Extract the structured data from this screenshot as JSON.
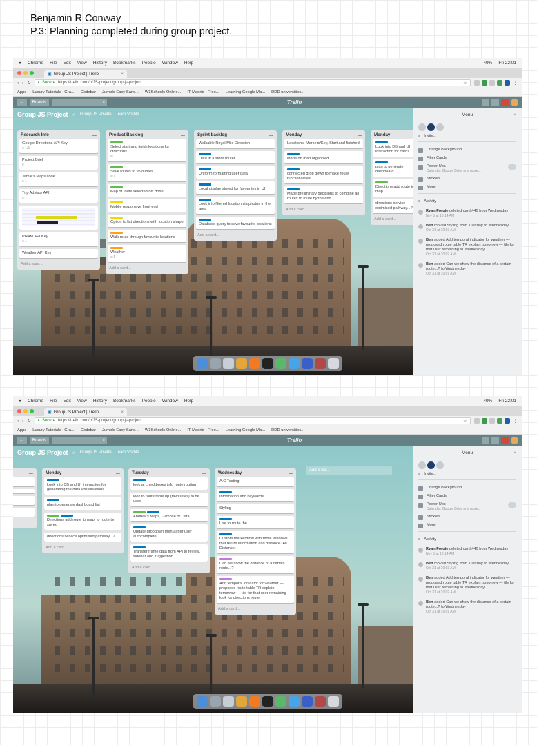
{
  "doc": {
    "author": "Benjamin R Conway",
    "subtitle": "P.3: Planning completed during group project."
  },
  "mac_menubar": {
    "items": [
      "Chrome",
      "File",
      "Edit",
      "View",
      "History",
      "Bookmarks",
      "People",
      "Window",
      "Help"
    ],
    "battery": "49%",
    "clock": "Fri 22:01"
  },
  "browser": {
    "tab_title": "Group JS Project | Trello",
    "url_secure": "Secure",
    "url": "https://trello.com/b/JS-project/group-js-project",
    "bookmarks": [
      "Apps",
      "Luxury Tutorials - Gra...",
      "Codebar",
      "Jumble Easy Sans...",
      "W3Schools Online...",
      "IT Madrid - Free...",
      "Learning Google Ma...",
      "DDD universities..."
    ]
  },
  "trello": {
    "boards_label": "Boards",
    "logo": "Trello",
    "board_title": "Group JS Project",
    "team": "Group JS Private",
    "team_visible": "Team Visible",
    "add_card": "Add a card...",
    "add_list": "Add a list..."
  },
  "screen1": {
    "lists": [
      {
        "title": "Research Info",
        "cards": [
          {
            "text": "Google Directions API Key",
            "meta": "≡ 1/1"
          },
          {
            "text": "Project Brief",
            "meta": "≡"
          },
          {
            "text": "Jamie's Maps code",
            "meta": "≡ 1"
          },
          {
            "text": "Trip Advisor API",
            "meta": "≡"
          },
          {
            "text": "",
            "image": true
          },
          {
            "text": "PHAM API Key",
            "meta": "≡ 1"
          },
          {
            "text": "Weather API Key",
            "meta": ""
          }
        ]
      },
      {
        "title": "Product Backlog",
        "cards": [
          {
            "labels": [
              "green"
            ],
            "text": "Select start and finish locations for directions",
            "meta": "≡"
          },
          {
            "labels": [
              "green"
            ],
            "text": "Save routes to favourites",
            "meta": "≡ 1"
          },
          {
            "labels": [
              "green"
            ],
            "text": "Map of route selected on 'done'",
            "meta": ""
          },
          {
            "labels": [
              "yellow"
            ],
            "text": "Mobile responsive front end",
            "meta": ""
          },
          {
            "labels": [
              "yellow"
            ],
            "text": "Option to list directions with location shape",
            "meta": ""
          },
          {
            "labels": [
              "orange"
            ],
            "text": "Walk route through favourite locations",
            "meta": ""
          },
          {
            "labels": [
              "orange"
            ],
            "text": "Weather",
            "meta": "≡ 1"
          }
        ]
      },
      {
        "title": "Sprint backlog",
        "cards": [
          {
            "labels": [],
            "text": "Walkable Royal Mile Direction",
            "meta": ""
          },
          {
            "labels": [
              "blue"
            ],
            "text": "Data in a store router",
            "meta": ""
          },
          {
            "labels": [
              "blue"
            ],
            "text": "Uniform formatting user data",
            "meta": ""
          },
          {
            "labels": [
              "blue"
            ],
            "text": "Local display stored for favourites in UI",
            "meta": ""
          },
          {
            "labels": [
              "blue"
            ],
            "text": "Look into filtered location via photos in the area",
            "meta": ""
          },
          {
            "labels": [
              "blue"
            ],
            "text": "Database query to save favourite locations",
            "meta": ""
          }
        ]
      },
      {
        "title": "Monday",
        "cards": [
          {
            "labels": [],
            "text": "Locations, Markers/Key, Start and finished",
            "meta": ""
          },
          {
            "labels": [
              "blue"
            ],
            "text": "Made on map organised",
            "meta": ""
          },
          {
            "labels": [
              "blue"
            ],
            "text": "connected drop down to make route functionalities",
            "meta": ""
          },
          {
            "labels": [
              "blue"
            ],
            "text": "Made preliminary decisions to combine all routes to route by the end",
            "meta": ""
          }
        ]
      },
      {
        "title": "Monday",
        "cards": [
          {
            "labels": [
              "blue"
            ],
            "text": "Look into DB and UI interaction for cards",
            "meta": ""
          },
          {
            "labels": [
              "blue"
            ],
            "text": "plan to generate dashboard",
            "meta": ""
          },
          {
            "labels": [
              "green"
            ],
            "text": "Directions add route to map",
            "meta": ""
          },
          {
            "labels": [],
            "text": "directions service optimised pathway...?",
            "meta": ""
          }
        ]
      }
    ]
  },
  "screen2": {
    "lists": [
      {
        "title": "",
        "cards": [
          {
            "labels": [],
            "text": "route",
            "meta": ""
          },
          {
            "labels": [],
            "text": "",
            "meta": ""
          },
          {
            "labels": [],
            "text": "s route",
            "meta": ""
          },
          {
            "labels": [],
            "text": "combine e...",
            "meta": ""
          }
        ]
      },
      {
        "title": "Monday",
        "cards": [
          {
            "labels": [
              "blue"
            ],
            "text": "Look into DB and UI interaction for generating the data visualisations",
            "meta": ""
          },
          {
            "labels": [
              "blue"
            ],
            "text": "plan to generate dashboard list",
            "meta": ""
          },
          {
            "labels": [
              "green",
              "blue"
            ],
            "text": "Directions add route to map, to route to saved",
            "meta": ""
          },
          {
            "labels": [],
            "text": "directions service optimised pathway...?",
            "meta": ""
          }
        ]
      },
      {
        "title": "Tuesday",
        "cards": [
          {
            "labels": [
              "blue"
            ],
            "text": "look at checkboxes info route routing",
            "meta": ""
          },
          {
            "labels": [],
            "text": "look to route table up (favourites) to be used",
            "meta": ""
          },
          {
            "labels": [
              "green",
              "blue"
            ],
            "text": "Andrew's Maps, Glimpse or Data",
            "meta": ""
          },
          {
            "labels": [
              "blue"
            ],
            "text": "Update dropdown menu after user autocomplete",
            "meta": ""
          },
          {
            "labels": [
              "blue"
            ],
            "text": "Transfer frame data from API to review, sidebar and suggestion",
            "meta": ""
          }
        ]
      },
      {
        "title": "Wednesday",
        "cards": [
          {
            "labels": [],
            "text": "A.C Testing",
            "meta": ""
          },
          {
            "labels": [
              "blue"
            ],
            "text": "Information and keywords",
            "meta": ""
          },
          {
            "labels": [],
            "text": "Styling",
            "meta": ""
          },
          {
            "labels": [
              "blue"
            ],
            "text": "Use to route the",
            "meta": ""
          },
          {
            "labels": [
              "blue"
            ],
            "text": "Custom marker/flow with more windows that return information and distance (All Distance)",
            "meta": ""
          },
          {
            "labels": [
              "purple"
            ],
            "text": "Can we show the distance of a certain route...?",
            "meta": ""
          },
          {
            "labels": [
              "purple"
            ],
            "text": "Add temporal indicator for weather — proposed route table TR explain tomorrow — tile for that user remaining — look for directions route",
            "meta": ""
          }
        ]
      }
    ]
  },
  "menu": {
    "title": "Menu",
    "team_label": "Invite...",
    "items": [
      {
        "icon": "image-icon",
        "label": "Change Background",
        "sub": ""
      },
      {
        "icon": "filter-icon",
        "label": "Filter Cards",
        "sub": ""
      },
      {
        "icon": "power-up-icon",
        "label": "Power-Ups",
        "sub": "Calendar, Google Drive and more..."
      },
      {
        "icon": "sticker-icon",
        "label": "Stickers",
        "sub": ""
      },
      {
        "icon": "more-icon",
        "label": "More",
        "sub": ""
      }
    ],
    "activity_title": "Activity",
    "activity": [
      {
        "who": "Ryan Forgie",
        "text": "deleted card #40 from Wednesday",
        "time": "Nov 5 at 10:14 AM"
      },
      {
        "who": "Ben",
        "text": "moved Styling from Tuesday to Wednesday",
        "time": "Oct 31 at 10:03 AM"
      },
      {
        "who": "Ben",
        "text": "added Add temporal indicator for weather — proposed route table TR explain tomorrow — tile for that user remaining to Wednesday",
        "time": "Oct 31 at 10:02 AM"
      },
      {
        "who": "Ben",
        "text": "added Can we show the distance of a certain route...? to Wednesday",
        "time": "Oct 31 at 10:01 AM"
      }
    ]
  },
  "colors": {
    "label_green": "#61bd4f",
    "label_yellow": "#f2d600",
    "label_orange": "#ff9f1a",
    "label_blue": "#0079bf",
    "label_purple": "#c377e0",
    "header": "#5a787d"
  }
}
